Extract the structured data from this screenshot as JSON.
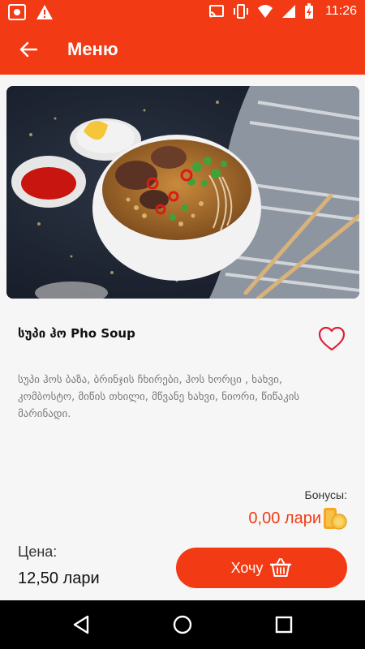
{
  "status_bar": {
    "time": "11:26",
    "left_icons": [
      "screen-record-icon",
      "warning-icon"
    ],
    "right_icons": [
      "cast-icon",
      "vibrate-icon",
      "wifi-icon",
      "signal-icon",
      "battery-charging-icon"
    ]
  },
  "app_bar": {
    "title": "Меню",
    "back_icon": "arrow-left-icon"
  },
  "dish": {
    "title": "სუპი ჰო Pho Soup",
    "ingredients": "სუპი ჰოს ბაზა, ბრინჯის ჩხირები, ჰოს ხორცი , ხახვი, კომბოსტო, მიწის თხილი, მწვანე ხახვი, ნიორი, წიწაკის მარინადი.",
    "photo_icon": "pho-soup-photo",
    "favorite_icon": "heart-outline-icon"
  },
  "bonus": {
    "label": "Бонусы:",
    "value": "0,00 лари",
    "icon": "coins-icon"
  },
  "price": {
    "label": "Цена:",
    "value": "12,50 лари"
  },
  "order_button": {
    "label": "Хочу",
    "icon": "basket-icon"
  },
  "colors": {
    "accent": "#f23a14",
    "background": "#f6f6f6",
    "text_muted": "#7a7a7a"
  },
  "nav_bar": {
    "icons": [
      "back-triangle-icon",
      "home-circle-icon",
      "recents-square-icon"
    ]
  }
}
